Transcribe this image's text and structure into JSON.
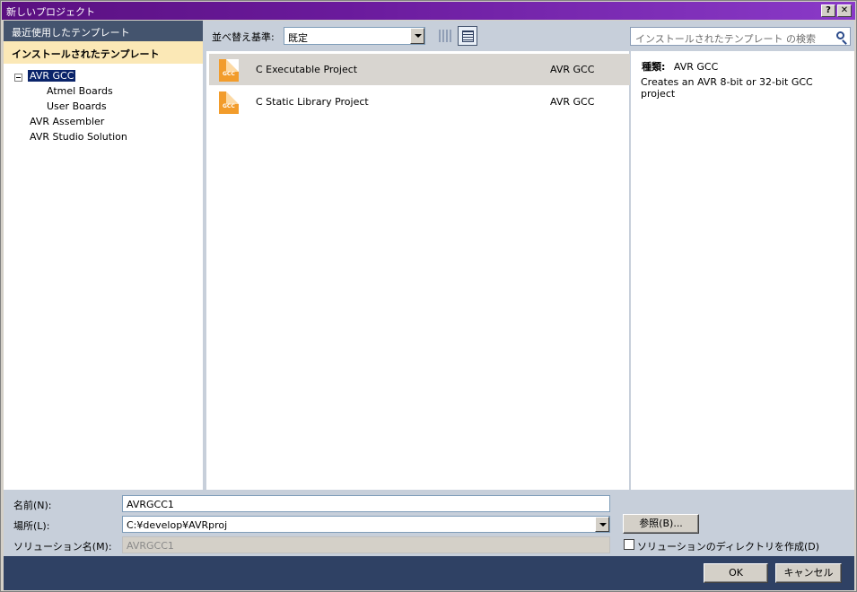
{
  "window": {
    "title": "新しいプロジェクト",
    "help_label": "?",
    "close_label": "✕"
  },
  "sidebar": {
    "recent_label": "最近使用したテンプレート",
    "installed_label": "インストールされたテンプレート",
    "tree": [
      {
        "label": "AVR GCC",
        "selected": true
      },
      {
        "label": "Atmel Boards"
      },
      {
        "label": "User Boards"
      },
      {
        "label": "AVR Assembler"
      },
      {
        "label": "AVR Studio Solution"
      }
    ]
  },
  "toolbar": {
    "sort_label": "並べ替え基準:",
    "sort_value": "既定",
    "search_placeholder": "インストールされたテンプレート の検索"
  },
  "templates": [
    {
      "name": "C Executable Project",
      "language": "AVR GCC",
      "icon": "gcc-project-icon",
      "selected": true
    },
    {
      "name": "C Static Library Project",
      "language": "AVR GCC",
      "icon": "gcc-project-icon",
      "selected": false
    }
  ],
  "icon_text": "GCC",
  "details": {
    "type_label": "種類:",
    "type_value": "AVR GCC",
    "description": "Creates an AVR 8-bit or 32-bit GCC project"
  },
  "form": {
    "name_label": "名前(N):",
    "name_value": "AVRGCC1",
    "location_label": "場所(L):",
    "location_value": "C:¥develop¥AVRproj",
    "solution_label": "ソリューション名(M):",
    "solution_value": "AVRGCC1",
    "browse_label": "参照(B)...",
    "create_dir_label": "ソリューションのディレクトリを作成(D)"
  },
  "buttons": {
    "ok": "OK",
    "cancel": "キャンセル"
  },
  "colors": {
    "title_gradient_start": "#5a1080",
    "sidebar_header": "#44546e",
    "installed_highlight": "#fbe8b6",
    "selection": "#0a246a",
    "footer": "#2f4164",
    "project_icon": "#f29c2b"
  }
}
